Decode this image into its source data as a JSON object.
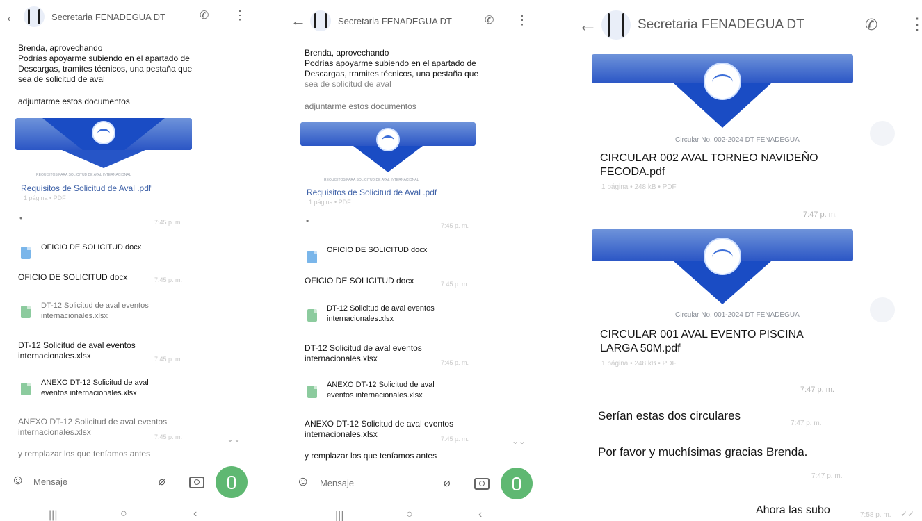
{
  "contact": {
    "name": "Secretaria FENADEGUA DT"
  },
  "composer": {
    "placeholder": "Mensaje"
  },
  "panel_left": {
    "msg_intro": [
      "Brenda, aprovechando",
      "Podrías apoyarme subiendo en el apartado de",
      "Descargas, tramites técnicos, una pestaña que",
      "sea de solicitud de aval"
    ],
    "msg_attach": "adjuntarme estos documentos",
    "banner_caption": "REQUISITOS PARA SOLICITUD DE AVAL INTERNACIONAL",
    "doc_requisitos": "Requisitos de Solicitud de Aval .pdf",
    "doc_requisitos_meta": "1 página • PDF",
    "dot": "•",
    "dot_time": "7:45 p. m.",
    "file_oficio": "OFICIO DE SOLICITUD docx",
    "caption_oficio": "OFICIO DE SOLICITUD docx",
    "time_oficio": "7:45 p. m.",
    "file_dt12": [
      "DT-12 Solicitud de aval eventos",
      "internacionales.xlsx"
    ],
    "caption_dt12": [
      "DT-12 Solicitud de aval eventos",
      "internacionales.xlsx"
    ],
    "time_dt12": "7:45 p. m.",
    "file_anexo": [
      "ANEXO DT-12 Solicitud de aval",
      "eventos internacionales.xlsx"
    ],
    "caption_anexo": [
      "ANEXO DT-12 Solicitud de aval eventos",
      "internacionales.xlsx"
    ],
    "time_anexo": "7:45 p. m.",
    "msg_replace": "y remplazar los que teníamos antes"
  },
  "panel_mid": {
    "msg_intro": [
      "Brenda, aprovechando",
      "Podrías apoyarme subiendo en el apartado de",
      "Descargas, tramites técnicos, una pestaña que",
      "sea de solicitud de aval"
    ],
    "msg_attach": "adjuntarme estos documentos",
    "banner_caption": "REQUISITOS PARA SOLICITUD DE AVAL INTERNACIONAL",
    "doc_requisitos": "Requisitos de Solicitud de Aval .pdf",
    "doc_requisitos_meta": "1 página • PDF",
    "dot": "•",
    "dot_time": "7:45 p. m.",
    "file_oficio": "OFICIO DE SOLICITUD docx",
    "caption_oficio": "OFICIO DE SOLICITUD docx",
    "time_oficio": "7:45 p. m.",
    "file_dt12": [
      "DT-12 Solicitud de aval eventos",
      "internacionales.xlsx"
    ],
    "caption_dt12": [
      "DT-12 Solicitud de aval eventos",
      "internacionales.xlsx"
    ],
    "time_dt12": "7:45 p. m.",
    "file_anexo": [
      "ANEXO DT-12 Solicitud de aval",
      "eventos internacionales.xlsx"
    ],
    "caption_anexo": [
      "ANEXO DT-12 Solicitud de aval eventos",
      "internacionales.xlsx"
    ],
    "time_anexo": "7:45 p. m.",
    "msg_replace": "y remplazar los que teníamos antes"
  },
  "panel_right": {
    "banner1_caption": "Circular No. 002-2024 DT FENADEGUA",
    "doc1_name": [
      "CIRCULAR 002 AVAL TORNEO NAVIDEÑO",
      "FECODA.pdf"
    ],
    "doc1_meta": "1 página • 248 kB • PDF",
    "doc1_time": "7:47 p. m.",
    "banner2_caption": "Circular No. 001-2024 DT FENADEGUA",
    "doc2_name": [
      "CIRCULAR 001 AVAL EVENTO PISCINA",
      "LARGA 50M.pdf"
    ],
    "doc2_meta": "1 página • 248 kB • PDF",
    "doc2_time": "7:47 p. m.",
    "msg_circulares": "Serían estas dos circulares",
    "msg_circulares_time": "7:47 p. m.",
    "msg_gracias": "Por favor y muchísimas gracias Brenda.",
    "msg_gracias_time": "7:47 p. m.",
    "msg_subo": "Ahora las subo",
    "msg_subo_time": "7:58 p. m."
  },
  "colors": {
    "mic_green": "#5fb872",
    "banner_blue": "#2b56c5",
    "doc_link": "#3f62a8"
  }
}
